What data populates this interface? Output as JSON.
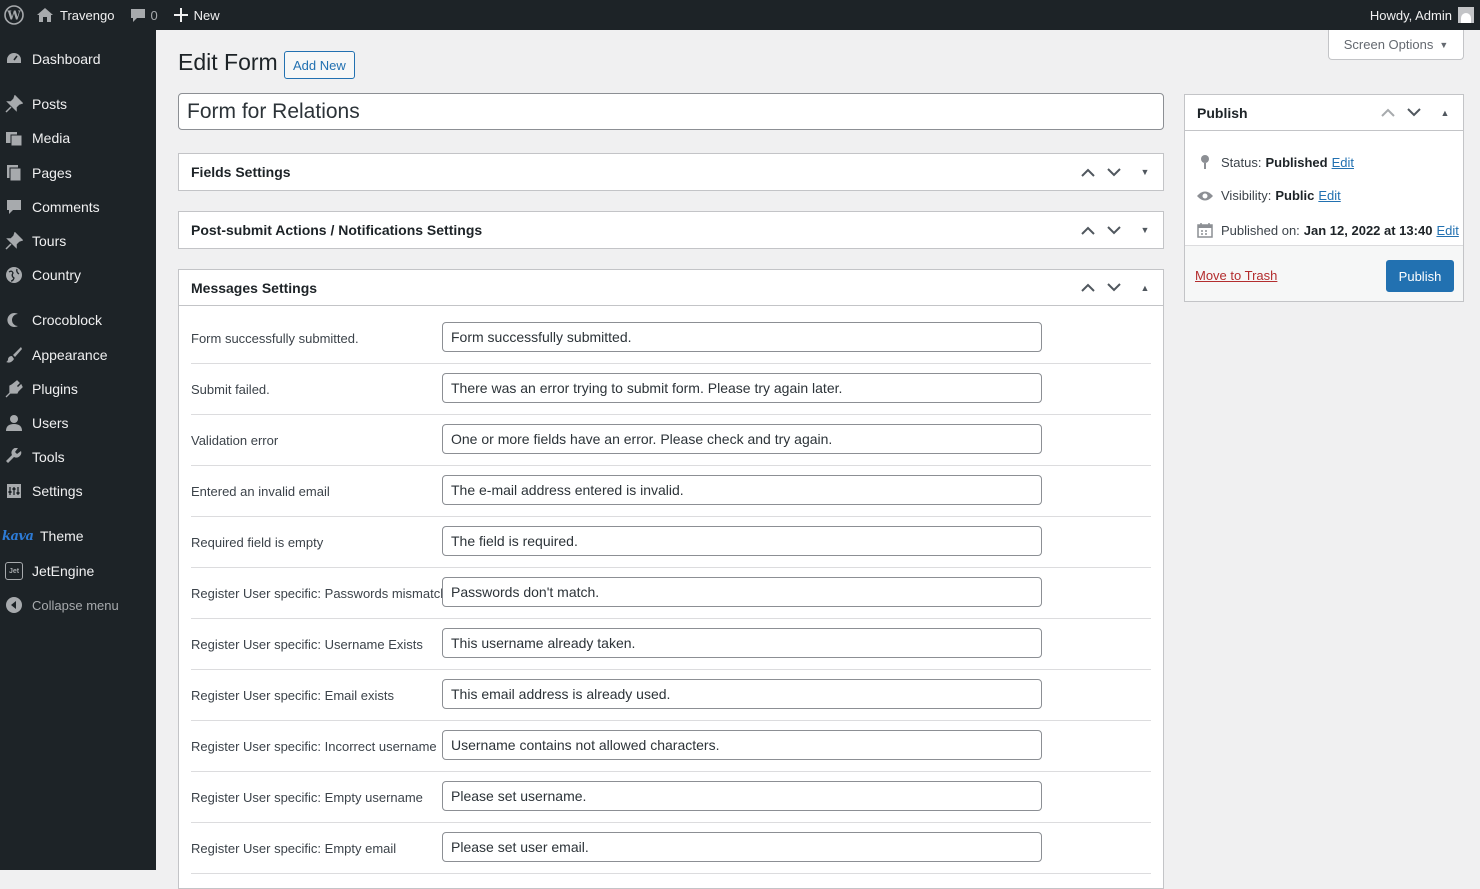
{
  "adminbar": {
    "site_name": "Travengo",
    "comments_count": "0",
    "new_label": "New",
    "howdy": "Howdy, Admin"
  },
  "sidebar": {
    "items": [
      {
        "label": "Dashboard",
        "icon": "dashboard-icon"
      },
      {
        "label": "Posts",
        "icon": "pin-icon"
      },
      {
        "label": "Media",
        "icon": "media-icon"
      },
      {
        "label": "Pages",
        "icon": "pages-icon"
      },
      {
        "label": "Comments",
        "icon": "comments-icon"
      },
      {
        "label": "Tours",
        "icon": "pin-icon"
      },
      {
        "label": "Country",
        "icon": "globe-icon"
      },
      {
        "label": "Crocoblock",
        "icon": "crocoblock-icon"
      },
      {
        "label": "Appearance",
        "icon": "brush-icon"
      },
      {
        "label": "Plugins",
        "icon": "plugin-icon"
      },
      {
        "label": "Users",
        "icon": "user-icon"
      },
      {
        "label": "Tools",
        "icon": "wrench-icon"
      },
      {
        "label": "Settings",
        "icon": "settings-icon"
      },
      {
        "label": "Theme",
        "icon": "kava-logo",
        "logo_text": "kava"
      },
      {
        "label": "JetEngine",
        "icon": "jetengine-icon",
        "logo_text": "Jet"
      },
      {
        "label": "Collapse menu",
        "icon": "collapse-icon"
      }
    ]
  },
  "screen_options": {
    "label": "Screen Options"
  },
  "page": {
    "title": "Edit Form",
    "add_new": "Add New",
    "form_title": "Form for Relations"
  },
  "postboxes": {
    "fields": "Fields Settings",
    "actions": "Post-submit Actions / Notifications Settings",
    "messages": "Messages Settings"
  },
  "messages": [
    {
      "label": "Form successfully submitted.",
      "value": "Form successfully submitted."
    },
    {
      "label": "Submit failed.",
      "value": "There was an error trying to submit form. Please try again later."
    },
    {
      "label": "Validation error",
      "value": "One or more fields have an error. Please check and try again."
    },
    {
      "label": "Entered an invalid email",
      "value": "The e-mail address entered is invalid."
    },
    {
      "label": "Required field is empty",
      "value": "The field is required."
    },
    {
      "label": "Register User specific: Passwords mismatch",
      "value": "Passwords don't match."
    },
    {
      "label": "Register User specific: Username Exists",
      "value": "This username already taken."
    },
    {
      "label": "Register User specific: Email exists",
      "value": "This email address is already used."
    },
    {
      "label": "Register User specific: Incorrect username",
      "value": "Username contains not allowed characters."
    },
    {
      "label": "Register User specific: Empty username",
      "value": "Please set username."
    },
    {
      "label": "Register User specific: Empty email",
      "value": "Please set user email."
    }
  ],
  "publish": {
    "title": "Publish",
    "status_label": "Status:",
    "status_value": "Published",
    "visibility_label": "Visibility:",
    "visibility_value": "Public",
    "published_on_label": "Published on:",
    "published_on_value": "Jan 12, 2022 at 13:40",
    "edit": "Edit",
    "move_to_trash": "Move to Trash",
    "publish_button": "Publish"
  },
  "colors": {
    "admin_bg": "#1d2327",
    "accent": "#2271b1",
    "trash": "#b32d2e",
    "page_bg": "#f0f0f1"
  }
}
